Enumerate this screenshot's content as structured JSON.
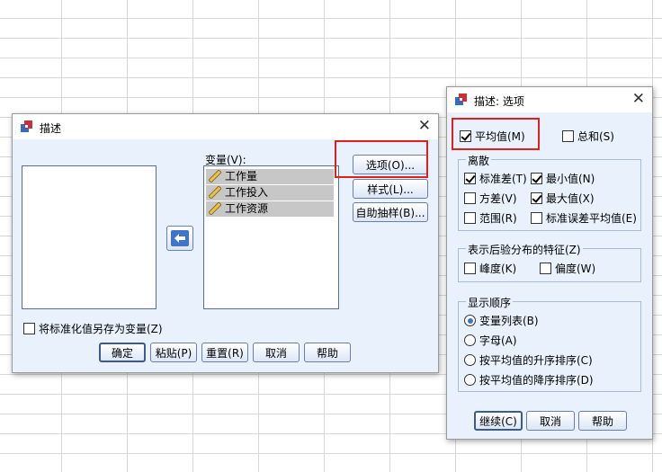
{
  "describe_dialog": {
    "title": "描述",
    "variables_label": "变量(V):",
    "variables": [
      "工作量",
      "工作投入",
      "工作资源"
    ],
    "save_std_label": "将标准化值另存为变量(Z)",
    "save_std_checked": false,
    "side_buttons": {
      "options": "选项(O)...",
      "style": "样式(L)...",
      "bootstrap": "自助抽样(B)..."
    },
    "bottom_buttons": {
      "ok": "确定",
      "paste": "粘贴(P)",
      "reset": "重置(R)",
      "cancel": "取消",
      "help": "帮助"
    }
  },
  "options_dialog": {
    "title": "描述: 选项",
    "mean": {
      "label": "平均值(M)",
      "checked": true
    },
    "sum": {
      "label": "总和(S)",
      "checked": false
    },
    "dispersion": {
      "title": "离散",
      "std_dev": {
        "label": "标准差(T)",
        "checked": true
      },
      "minimum": {
        "label": "最小值(N)",
        "checked": true
      },
      "variance": {
        "label": "方差(V)",
        "checked": false
      },
      "maximum": {
        "label": "最大值(X)",
        "checked": true
      },
      "range": {
        "label": "范围(R)",
        "checked": false
      },
      "se_mean": {
        "label": "标准误差平均值(E)",
        "checked": false
      }
    },
    "distribution": {
      "title": "表示后验分布的特征(Z)",
      "kurtosis": {
        "label": "峰度(K)",
        "checked": false
      },
      "skewness": {
        "label": "偏度(W)",
        "checked": false
      }
    },
    "display_order": {
      "title": "显示顺序",
      "options": [
        "变量列表(B)",
        "字母(A)",
        "按平均值的升序排序(C)",
        "按平均值的降序排序(D)"
      ],
      "selected_index": 0
    },
    "buttons": {
      "continue": "继续(C)",
      "cancel": "取消",
      "help": "帮助"
    }
  },
  "colors": {
    "dialog_body": "#e8f1fc",
    "highlight_box": "#e02020",
    "grid_line": "#d8d8d8"
  }
}
